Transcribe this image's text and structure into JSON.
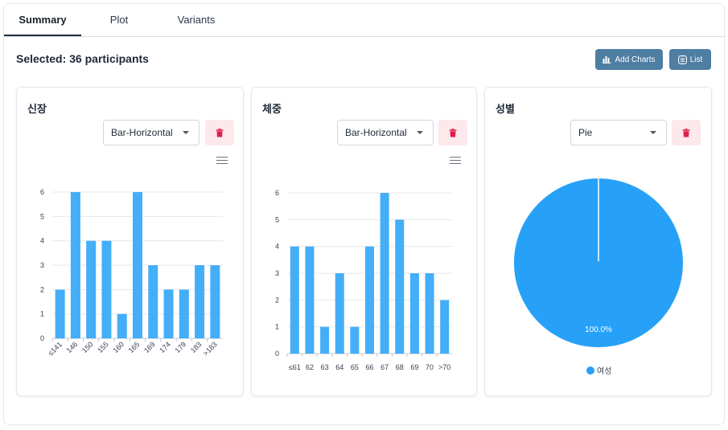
{
  "tabs": [
    {
      "label": "Summary",
      "active": true
    },
    {
      "label": "Plot",
      "active": false
    },
    {
      "label": "Variants",
      "active": false
    }
  ],
  "selected_text": "Selected: 36 participants",
  "buttons": {
    "add_charts": "Add Charts",
    "list": "List"
  },
  "colors": {
    "bar": "#44aef8",
    "pie": "#27a1f7",
    "button": "#4f7ea3",
    "trash_bg": "#fde8ec",
    "trash_icon": "#e11d48"
  },
  "cards": [
    {
      "title": "신장",
      "select_value": "Bar-Horizontal"
    },
    {
      "title": "체중",
      "select_value": "Bar-Horizontal"
    },
    {
      "title": "성별",
      "select_value": "Pie"
    }
  ],
  "chart_data": [
    {
      "type": "bar",
      "categories": [
        "≤141",
        "146",
        "150",
        "155",
        "160",
        "165",
        "169",
        "174",
        "179",
        "183",
        ">183"
      ],
      "values": [
        2,
        6,
        4,
        4,
        1,
        6,
        3,
        2,
        2,
        3,
        3
      ],
      "yticks": [
        "0",
        "1",
        "2",
        "3",
        "4",
        "5",
        "6"
      ],
      "ylim": [
        0,
        6
      ],
      "grid": true
    },
    {
      "type": "bar",
      "categories": [
        "≤61",
        "62",
        "63",
        "64",
        "65",
        "66",
        "67",
        "68",
        "69",
        "70",
        ">70"
      ],
      "values": [
        4,
        4,
        1,
        3,
        1,
        4,
        6,
        5,
        3,
        3,
        2
      ],
      "yticks": [
        "0",
        "1",
        "2",
        "3",
        "4",
        "5",
        "6"
      ],
      "ylim": [
        0,
        6
      ],
      "grid": true
    },
    {
      "type": "pie",
      "slices": [
        {
          "name": "여성",
          "value": 100.0
        }
      ],
      "data_label": "100.0%",
      "legend": "bottom"
    }
  ]
}
